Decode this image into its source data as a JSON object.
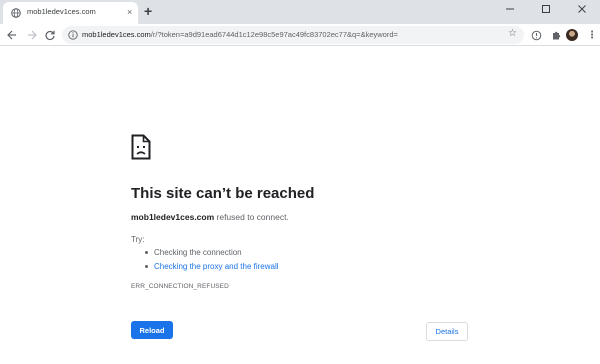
{
  "tab": {
    "title": "mob1ledev1ces.com",
    "close_glyph": "×",
    "favicon": "globe-icon"
  },
  "new_tab_glyph": "+",
  "window": {
    "minimize_glyph": "—",
    "maximize_glyph": "☐",
    "close_glyph": "✕"
  },
  "toolbar": {
    "url_host": "mob1ledev1ces.com",
    "url_rest": "/r/?token=a9d91ead6744d1c12e98c5e97ac49fc83702ec77&q=&keyword=",
    "star_glyph": "☆",
    "menu_glyph": "⋮"
  },
  "error": {
    "heading": "This site can’t be reached",
    "host": "mob1ledev1ces.com",
    "description_suffix": " refused to connect.",
    "try_label": "Try:",
    "suggestions": [
      "Checking the connection",
      "Checking the proxy and the firewall"
    ],
    "code": "ERR_CONNECTION_REFUSED",
    "reload_label": "Reload",
    "details_label": "Details"
  },
  "colors": {
    "accent": "#1a73e8",
    "tabstrip_bg": "#dee1e6",
    "omnibox_bg": "#f1f3f4"
  }
}
